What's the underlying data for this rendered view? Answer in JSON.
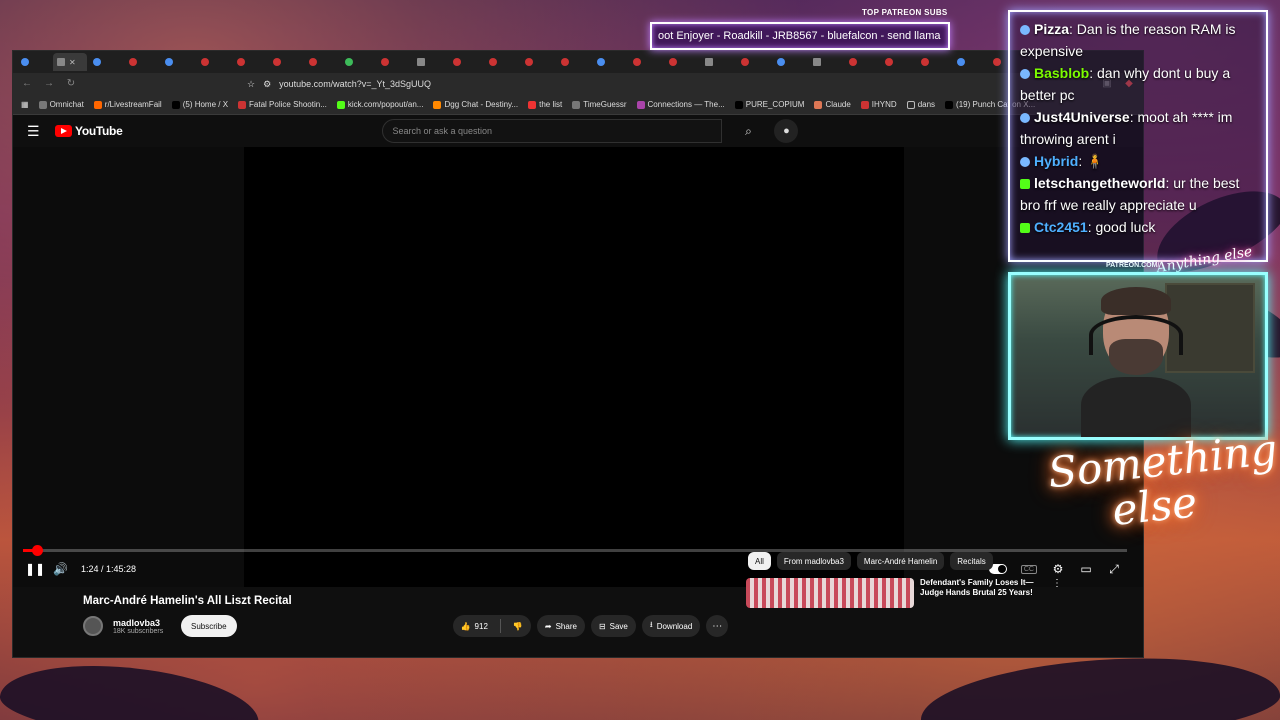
{
  "overlay": {
    "patreon_label": "TOP PATREON SUBS",
    "ticker_text": "oot Enjoyer - Roadkill - JRB8567 - bluefalcon - send llama",
    "patreon_url": "PATREON.COM/",
    "signature_small": "Anything else",
    "neon_line1": "Something",
    "neon_line2": "else"
  },
  "chat": [
    {
      "user": "Pizza",
      "msg": ": Dan is the reason RAM is expensive",
      "color": "#ffffff",
      "badge": "tw"
    },
    {
      "user": "Basblob",
      "msg": ": dan why dont u buy a better pc",
      "color": "#7cfc00",
      "badge": "tw"
    },
    {
      "user": "Just4Universe",
      "msg": ": moot ah **** im throwing arent i",
      "color": "#ffffff",
      "badge": "tw"
    },
    {
      "user": "Hybrid",
      "msg": ":",
      "color": "#4fb0ff",
      "badge": "tw"
    },
    {
      "user": "letschangetheworld",
      "msg": ": ur the best bro frf we really appreciate u",
      "color": "#ffffff",
      "badge": "k"
    },
    {
      "user": "Ctc2451",
      "msg": ": good luck",
      "color": "#4fb0ff",
      "badge": "k"
    }
  ],
  "browser": {
    "url": "youtube.com/watch?v=_Yt_3dSgUUQ",
    "bookmarks": [
      "Omnichat",
      "r/LivestreamFail",
      "(5) Home / X",
      "Fatal Police Shootin...",
      "kick.com/popout/an...",
      "Dgg Chat - Destiny...",
      "the list",
      "TimeGuessr",
      "Connections — The...",
      "PURE_COPIUM",
      "Claude",
      "IHYND",
      "dans",
      "(19) Punch Cat on X..."
    ]
  },
  "youtube": {
    "logo": "YouTube",
    "search_placeholder": "Search or ask a question",
    "time": "1:24 / 1:45:28",
    "progress_fraction": 0.013,
    "video_title": "Marc-André Hamelin's All Liszt Recital",
    "channel_name": "madlovba3",
    "subscribers": "18K subscribers",
    "subscribe_label": "Subscribe",
    "like_count": "912",
    "share_label": "Share",
    "save_label": "Save",
    "download_label": "Download",
    "chips": [
      "All",
      "From madlovba3",
      "Marc-André Hamelin",
      "Recitals"
    ],
    "rec_title": "Defendant's Family Loses It— Judge Hands Brutal 25 Years!"
  }
}
